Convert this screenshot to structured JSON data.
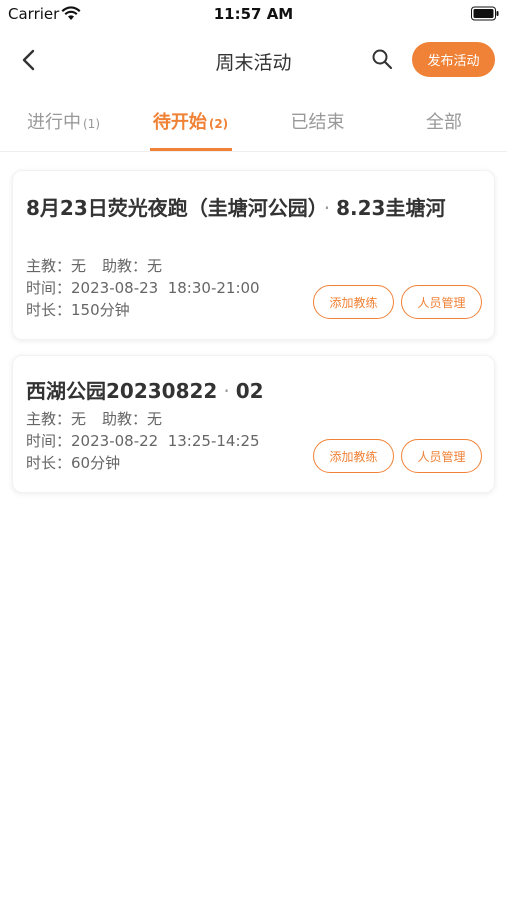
{
  "status_bar": {
    "carrier": "Carrier",
    "time": "11:57 AM"
  },
  "nav": {
    "title": "周末活动",
    "publish_label": "发布活动"
  },
  "tabs": [
    {
      "label": "进行中",
      "count": "(1)",
      "active": false
    },
    {
      "label": "待开始",
      "count": "(2)",
      "active": true
    },
    {
      "label": "已结束",
      "count": "",
      "active": false
    },
    {
      "label": "全部",
      "count": "",
      "active": false
    }
  ],
  "activities": [
    {
      "title_main": "8月23日荧光夜跑（圭塘河公园）",
      "dot": "·",
      "title_suffix": "8.23圭塘河",
      "coach_label": "主教：",
      "coach": "无",
      "assistant_label": "助教：",
      "assistant": "无",
      "time_label": "时间：",
      "time": "2023-08-23  18:30-21:00",
      "duration_label": "时长：",
      "duration": "150分钟",
      "add_coach_label": "添加教练",
      "member_manage_label": "人员管理"
    },
    {
      "title_main": "西湖公园20230822",
      "dot": "·",
      "title_suffix": "02",
      "coach_label": "主教：",
      "coach": "无",
      "assistant_label": "助教：",
      "assistant": "无",
      "time_label": "时间：",
      "time": "2023-08-22  13:25-14:25",
      "duration_label": "时长：",
      "duration": "60分钟",
      "add_coach_label": "添加教练",
      "member_manage_label": "人员管理"
    }
  ],
  "colors": {
    "accent": "#f08237",
    "text": "#333333",
    "muted": "#999999"
  }
}
